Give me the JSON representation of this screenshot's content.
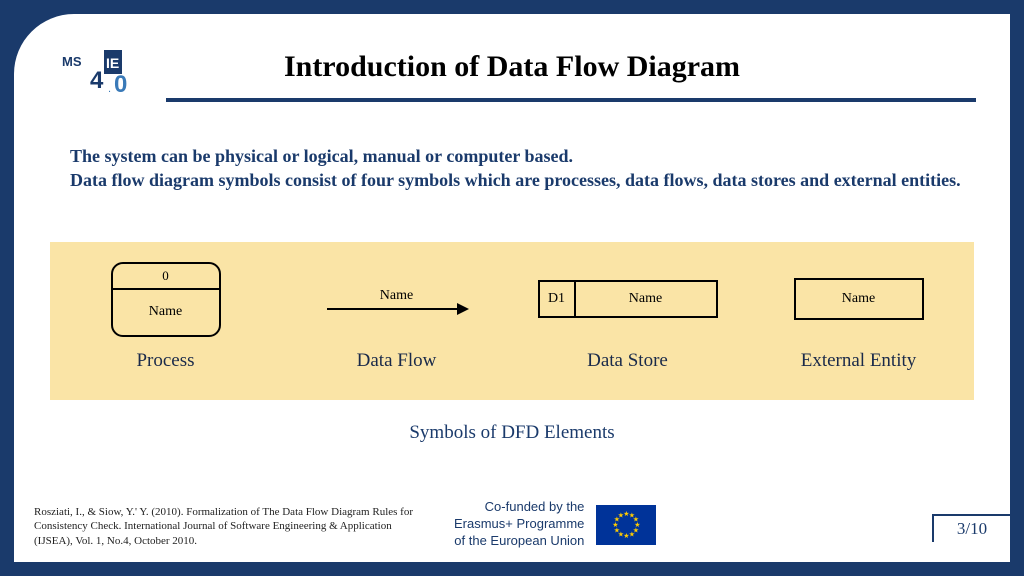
{
  "title": "Introduction of Data Flow Diagram",
  "body": "The system can be physical or logical, manual or computer based.\nData flow diagram symbols consist of four symbols which are processes, data flows, data stores and external entities.",
  "body_line1": "The system can be physical or logical, manual or computer based.",
  "body_line2": "Data flow diagram symbols consist of four symbols which are processes, data flows, data stores and external entities.",
  "symbols": {
    "process": {
      "label": "Process",
      "id": "0",
      "name": "Name"
    },
    "dataflow": {
      "label": "Data Flow",
      "name": "Name"
    },
    "datastore": {
      "label": "Data Store",
      "id": "D1",
      "name": "Name"
    },
    "entity": {
      "label": "External Entity",
      "name": "Name"
    }
  },
  "caption": "Symbols of DFD Elements",
  "citation": "Rosziati, I., & Siow, Y.' Y. (2010). Formalization of The Data Flow Diagram Rules for Consistency Check. International Journal of Software Engineering & Application (IJSEA), Vol. 1, No.4, October 2010.",
  "cofunded": {
    "line1": "Co-funded by the",
    "line2": "Erasmus+ Programme",
    "line3": "of the European Union"
  },
  "page": "3/10",
  "logo_text": "MSIE"
}
